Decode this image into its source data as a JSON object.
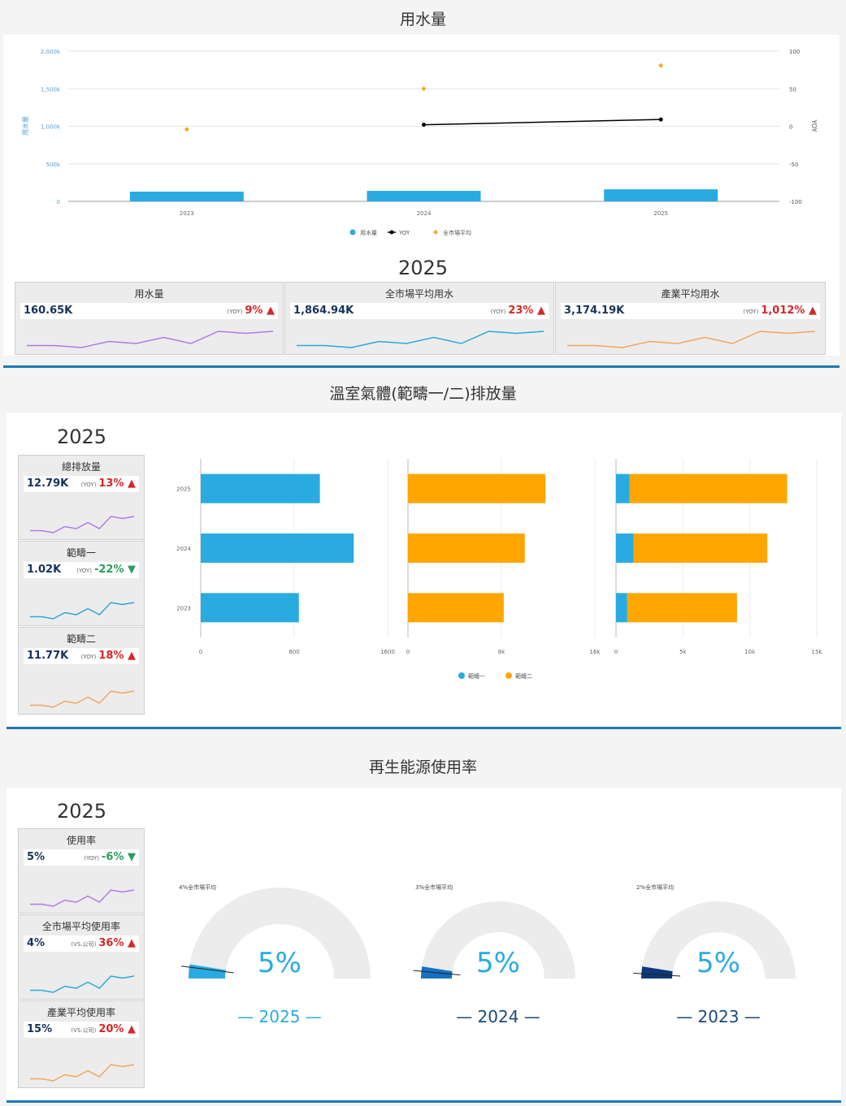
{
  "sections": {
    "water_title": "用水量",
    "ghg_title": "溫室氣體(範疇一/二)排放量",
    "renew_title": "再生能源使用率"
  },
  "year": "2025",
  "water_kpis": [
    {
      "label": "用水量",
      "value": "160.65K",
      "tag": "(YOY)",
      "change": "9%",
      "dir": "up",
      "color": "#b07be8"
    },
    {
      "label": "全市場平均用水",
      "value": "1,864.94K",
      "tag": "(YOY)",
      "change": "23%",
      "dir": "up",
      "color": "#2aa8d8"
    },
    {
      "label": "產業平均用水",
      "value": "3,174.19K",
      "tag": "(YOY)",
      "change": "1,012%",
      "dir": "up",
      "color": "#f5a55a"
    }
  ],
  "ghg_kpis": [
    {
      "label": "總排放量",
      "value": "12.79K",
      "tag": "(YOY)",
      "change": "13%",
      "dir": "up",
      "color": "#b07be8"
    },
    {
      "label": "範疇一",
      "value": "1.02K",
      "tag": "(YOY)",
      "change": "-22%",
      "dir": "down",
      "color": "#2aa8d8"
    },
    {
      "label": "範疇二",
      "value": "11.77K",
      "tag": "(YOY)",
      "change": "18%",
      "dir": "up",
      "color": "#f5a55a"
    }
  ],
  "renew_kpis": [
    {
      "label": "使用率",
      "value": "5%",
      "tag": "(YOY)",
      "change": "-6%",
      "dir": "down",
      "color": "#b07be8"
    },
    {
      "label": "全市場平均使用率",
      "value": "4%",
      "tag": "(VS.公司)",
      "change": "36%",
      "dir": "up",
      "color": "#2aa8d8"
    },
    {
      "label": "產業平均使用率",
      "value": "15%",
      "tag": "(VS.公司)",
      "change": "20%",
      "dir": "up",
      "color": "#f5a55a"
    }
  ],
  "chart_data": [
    {
      "type": "bar",
      "title": "",
      "categories": [
        "2023",
        "2024",
        "2025"
      ],
      "ylabel": "用水量",
      "y2label": "YOY",
      "ylim": [
        0,
        2000000
      ],
      "y2lim": [
        -100,
        100
      ],
      "yticks": [
        "0",
        "500k",
        "1,000k",
        "1,500k",
        "2,000k"
      ],
      "y2ticks": [
        "-100",
        "-50",
        "0",
        "50",
        "100"
      ],
      "series": [
        {
          "name": "用水量",
          "kind": "bar",
          "axis": "left",
          "color": "#29abe2",
          "values": [
            130000,
            140000,
            160650
          ]
        },
        {
          "name": "YOY",
          "kind": "line",
          "axis": "right",
          "color": "#000000",
          "values": [
            null,
            2,
            9
          ]
        },
        {
          "name": "全市場平均",
          "kind": "point",
          "axis": "right",
          "color": "#f5a623",
          "values": [
            -4,
            50,
            81
          ]
        }
      ]
    },
    {
      "type": "bar",
      "orientation": "horizontal",
      "categories": [
        "2025",
        "2024",
        "2023"
      ],
      "panels": [
        {
          "xlim": [
            0,
            1600
          ],
          "xticks": [
            "0",
            "800",
            "1600"
          ],
          "series": [
            {
              "name": "範疇一",
              "values": [
                1020,
                1310,
                840
              ]
            }
          ]
        },
        {
          "xlim": [
            0,
            16000
          ],
          "xticks": [
            "0",
            "8k",
            "16k"
          ],
          "series": [
            {
              "name": "範疇二",
              "values": [
                11770,
                10000,
                8200
              ]
            }
          ]
        },
        {
          "xlim": [
            0,
            15000
          ],
          "xticks": [
            "0",
            "5k",
            "10k",
            "15k"
          ],
          "stacked": true,
          "series": [
            {
              "name": "範疇一",
              "values": [
                1020,
                1310,
                840
              ]
            },
            {
              "name": "範疇二",
              "values": [
                11770,
                10000,
                8200
              ]
            }
          ]
        }
      ],
      "legend": [
        {
          "name": "範疇一",
          "color": "#29abe2"
        },
        {
          "name": "範疇二",
          "color": "#ffa600"
        }
      ]
    },
    {
      "type": "gauge",
      "gauges": [
        {
          "year": "— 2025 —",
          "value": 5,
          "value_label": "5%",
          "market": 4,
          "market_label": "4%全市場平均"
        },
        {
          "year": "— 2024 —",
          "value": 5,
          "value_label": "5%",
          "market": 3,
          "market_label": "3%全市場平均"
        },
        {
          "year": "— 2023 —",
          "value": 5,
          "value_label": "5%",
          "market": 2,
          "market_label": "2%全市場平均"
        }
      ]
    }
  ],
  "spark": [
    4,
    4,
    3,
    6,
    5,
    8,
    5,
    11,
    10,
    11
  ]
}
